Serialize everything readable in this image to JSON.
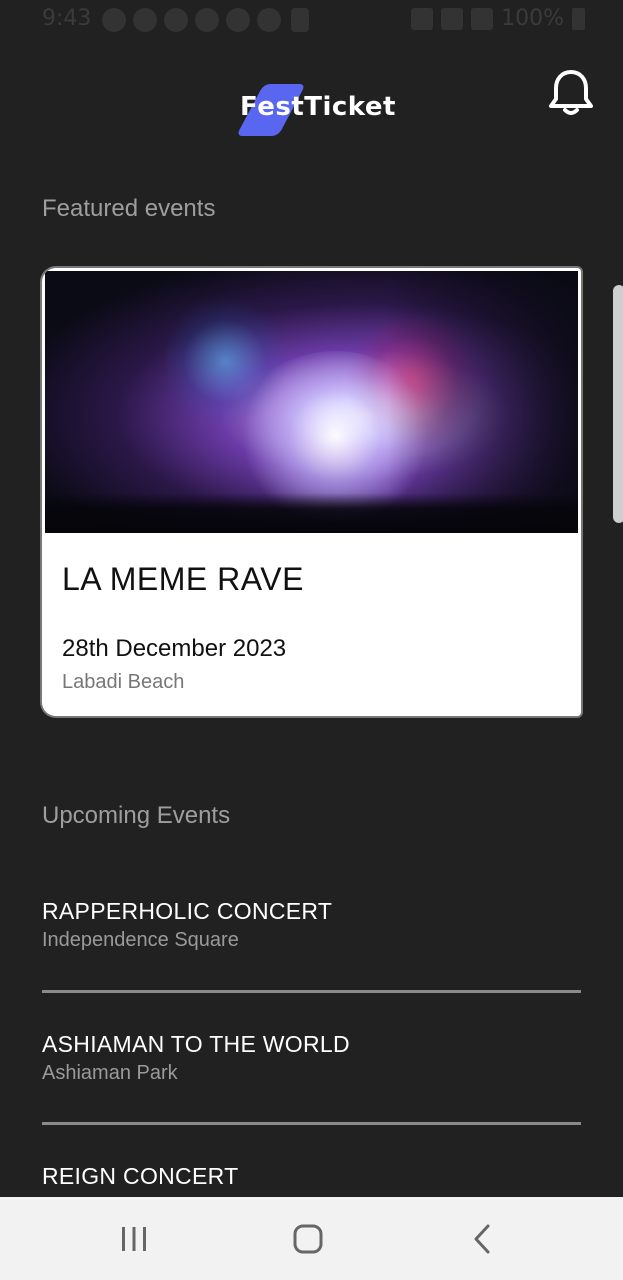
{
  "status_bar": {
    "time": "9:43",
    "battery_text": "100%"
  },
  "header": {
    "logo_text": "FestTicket",
    "logo_color": "#5966f0",
    "notification_icon": "bell-icon"
  },
  "featured": {
    "section_title": "Featured events",
    "card": {
      "image_icon": "concert-image",
      "name": "LA MEME RAVE",
      "date": "28th December 2023",
      "venue": "Labadi Beach"
    }
  },
  "upcoming": {
    "section_title": "Upcoming Events",
    "items": [
      {
        "name": "RAPPERHOLIC CONCERT",
        "venue": "Independence Square"
      },
      {
        "name": "ASHIAMAN TO THE WORLD",
        "venue": "Ashiaman Park"
      },
      {
        "name": "REIGN CONCERT",
        "venue": ""
      }
    ]
  },
  "nav_bar": {
    "recent_icon": "recent-apps-icon",
    "home_icon": "home-icon",
    "back_icon": "back-icon"
  }
}
